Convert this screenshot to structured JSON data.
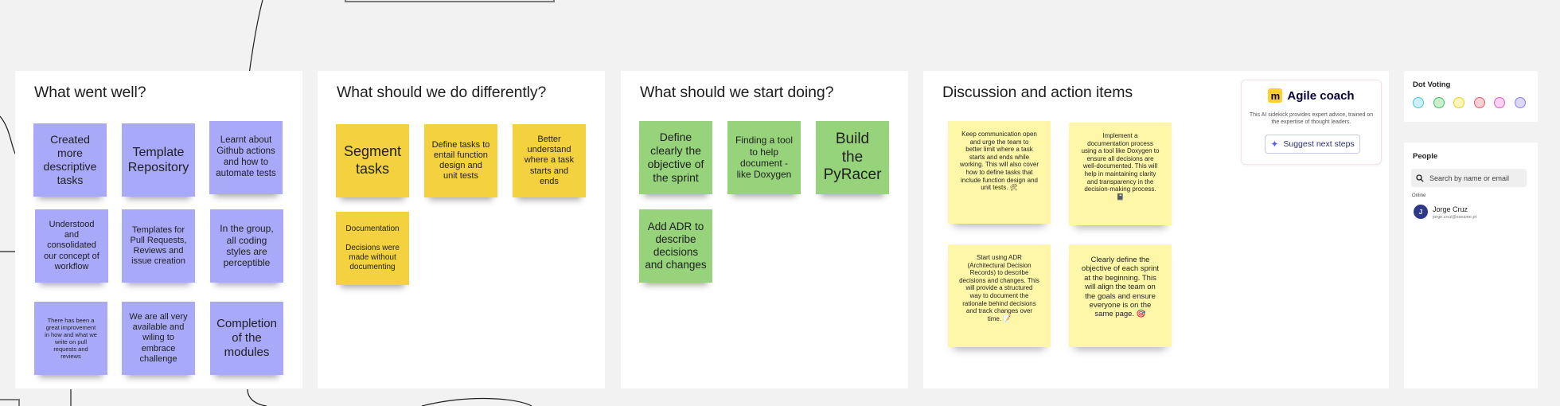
{
  "frames": {
    "went_well": {
      "title": "What went well?",
      "notes": [
        "Created\nmore\ndescriptive\ntasks",
        "Template\nRepository",
        "Learnt about\nGithub actions\nand how to\nautomate tests",
        "Understood\nand\nconsolidated\nour concept of\nworkflow",
        "Templates for\nPull Requests,\nReviews and\nissue creation",
        "In the group,\nall coding\nstyles are\nperceptible",
        "There has been a\ngreat improvement\nin how and what we\nwrite on pull\nrequests and\nreviews",
        "We are all very\navailable and\nwiling to\nembrace\nchallenge",
        "Completion\nof the\nmodules"
      ]
    },
    "differently": {
      "title": "What should we do differently?",
      "notes": [
        "Segment\ntasks",
        "Define tasks to\nentail function\ndesign and\nunit tests",
        "Better\nunderstand\nwhere a task\nstarts and\nends",
        "Documentation\n\nDecisions were\nmade without\ndocumenting"
      ]
    },
    "start": {
      "title": "What should we start doing?",
      "notes": [
        "Define\nclearly the\nobjective of\nthe sprint",
        "Finding a tool\nto help\ndocument -\nlike Doxygen",
        "Build\nthe\nPyRacer",
        "Add ADR to\ndescribe\ndecisions\nand changes"
      ]
    },
    "discussion": {
      "title": "Discussion and action items",
      "notes": [
        "Keep communication open\nand urge the team to\nbetter limit where a task\nstarts and ends while\nworking. This will also cover\nhow to define tasks that\ninclude function design and\nunit tests. 🛠",
        "Implement a\ndocumentation process\nusing a tool like Doxygen to\nensure all decisions are\nwell-documented. This will\nhelp in maintaining clarity\nand transparency in the\ndecision-making process.\n📓",
        "Start using ADR\n(Architectural Decision\nRecords) to describe\ndecisions and changes. This\nwill provide a structured\nway to document the\nrationale behind decisions\nand track changes over\ntime. 📝",
        "Clearly define the\nobjective of each sprint\nat the beginning. This\nwill align the team on\nthe goals and ensure\neveryone is on the\nsame page. 🎯"
      ]
    }
  },
  "agile_coach": {
    "logo": "m",
    "title": "Agile coach",
    "description": "This AI sidekick provides expert advice, trained on the expertise of thought leaders.",
    "button": "Suggest next steps"
  },
  "dot_voting": {
    "title": "Dot Voting",
    "dots": [
      {
        "fill": "#c9f0f5",
        "border": "#4fc3d6"
      },
      {
        "fill": "#c8f0cf",
        "border": "#3fc160"
      },
      {
        "fill": "#fdf6b6",
        "border": "#e8cc2a"
      },
      {
        "fill": "#fbd0d4",
        "border": "#ea5a6a"
      },
      {
        "fill": "#fbd1ef",
        "border": "#e05ac5"
      },
      {
        "fill": "#dcd6fb",
        "border": "#8b7de8"
      }
    ]
  },
  "people": {
    "title": "People",
    "search_placeholder": "Search by name or email",
    "online_label": "Online",
    "user": {
      "initial": "J",
      "name": "Jorge Cruz",
      "email": "jorge.cruz@sseame.pt"
    }
  },
  "colors": {
    "violet": "#a8a9f9",
    "yellow": "#f4d13f",
    "green": "#96d37a",
    "pale_yellow": "#fff7a8",
    "canvas": "#f2f2f2"
  }
}
